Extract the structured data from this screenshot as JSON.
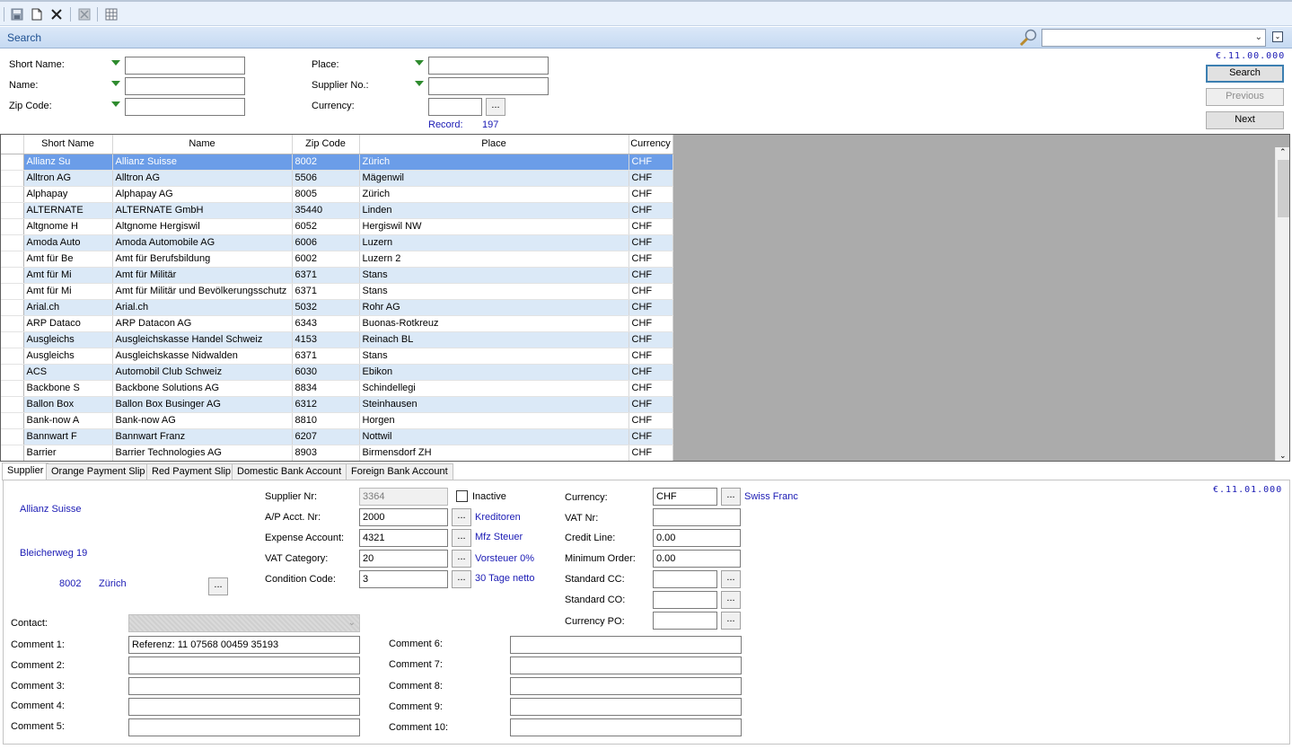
{
  "toolbar": {
    "icons": [
      "save-icon",
      "new-document-icon",
      "delete-icon",
      "cancel-icon",
      "grid-icon"
    ]
  },
  "search_bar": {
    "title": "Search",
    "combo_value": ""
  },
  "search_form": {
    "short_name_label": "Short Name:",
    "name_label": "Name:",
    "zip_label": "Zip Code:",
    "place_label": "Place:",
    "supplier_no_label": "Supplier No.:",
    "currency_label": "Currency:",
    "short_name_value": "",
    "name_value": "",
    "zip_value": "",
    "place_value": "",
    "supplier_no_value": "",
    "currency_value": "",
    "dots_label": "...",
    "record_label": "Record:",
    "record_count": "197",
    "version": "€.11.00.000",
    "search_button": "Search",
    "previous_button": "Previous",
    "next_button": "Next"
  },
  "grid": {
    "columns": [
      "Short Name",
      "Name",
      "Zip Code",
      "Place",
      "Currency"
    ],
    "rows": [
      [
        "Allianz Su",
        "Allianz Suisse",
        "8002",
        "Zürich",
        "CHF"
      ],
      [
        "Alltron AG",
        "Alltron AG",
        "5506",
        "Mägenwil",
        "CHF"
      ],
      [
        "Alphapay",
        "Alphapay AG",
        "8005",
        "Zürich",
        "CHF"
      ],
      [
        "ALTERNATE",
        "ALTERNATE GmbH",
        "35440",
        "Linden",
        "CHF"
      ],
      [
        "Altgnome H",
        "Altgnome Hergiswil",
        "6052",
        "Hergiswil NW",
        "CHF"
      ],
      [
        "Amoda Auto",
        "Amoda Automobile AG",
        "6006",
        "Luzern",
        "CHF"
      ],
      [
        "Amt für Be",
        "Amt für Berufsbildung",
        "6002",
        "Luzern 2",
        "CHF"
      ],
      [
        "Amt für Mi",
        "Amt für Militär",
        "6371",
        "Stans",
        "CHF"
      ],
      [
        "Amt für Mi",
        "Amt für Militär und Bevölkerungsschutz",
        "6371",
        "Stans",
        "CHF"
      ],
      [
        "Arial.ch",
        "Arial.ch",
        "5032",
        "Rohr AG",
        "CHF"
      ],
      [
        "ARP Dataco",
        "ARP Datacon AG",
        "6343",
        "Buonas-Rotkreuz",
        "CHF"
      ],
      [
        "Ausgleichs",
        "Ausgleichskasse Handel Schweiz",
        "4153",
        "Reinach BL",
        "CHF"
      ],
      [
        "Ausgleichs",
        "Ausgleichskasse Nidwalden",
        "6371",
        "Stans",
        "CHF"
      ],
      [
        "ACS",
        "Automobil Club Schweiz",
        "6030",
        "Ebikon",
        "CHF"
      ],
      [
        "Backbone S",
        "Backbone Solutions AG",
        "8834",
        "Schindellegi",
        "CHF"
      ],
      [
        "Ballon Box",
        "Ballon Box Businger AG",
        "6312",
        "Steinhausen",
        "CHF"
      ],
      [
        "Bank-now A",
        "Bank-now AG",
        "8810",
        "Horgen",
        "CHF"
      ],
      [
        "Bannwart F",
        "Bannwart Franz",
        "6207",
        "Nottwil",
        "CHF"
      ],
      [
        "Barrier",
        "Barrier Technologies AG",
        "8903",
        "Birmensdorf ZH",
        "CHF"
      ]
    ]
  },
  "tabs": [
    "Supplier",
    "Orange Payment Slip",
    "Red Payment Slip",
    "Domestic Bank Account",
    "Foreign Bank Account"
  ],
  "detail": {
    "version": "€.11.01.000",
    "company": "Allianz Suisse",
    "street": "Bleicherweg 19",
    "zip": "8002",
    "city": "Zürich",
    "supplier_nr_label": "Supplier Nr:",
    "supplier_nr": "3364",
    "inactive_label": "Inactive",
    "ap_acct_label": "A/P Acct. Nr:",
    "ap_acct": "2000",
    "ap_acct_desc": "Kreditoren",
    "expense_label": "Expense Account:",
    "expense": "4321",
    "expense_desc": "Mfz Steuer",
    "vat_cat_label": "VAT Category:",
    "vat_cat": "20",
    "vat_cat_desc": "Vorsteuer 0%",
    "condition_label": "Condition Code:",
    "condition": "3",
    "condition_desc": "30 Tage netto",
    "currency_label": "Currency:",
    "currency": "CHF",
    "currency_desc": "Swiss Franc",
    "vat_nr_label": "VAT Nr:",
    "vat_nr": "",
    "credit_label": "Credit Line:",
    "credit": "0.00",
    "min_order_label": "Minimum Order:",
    "min_order": "0.00",
    "std_cc_label": "Standard CC:",
    "std_cc": "",
    "std_co_label": "Standard CO:",
    "std_co": "",
    "currency_po_label": "Currency PO:",
    "currency_po": "",
    "contact_label": "Contact:",
    "comments_left": [
      {
        "label": "Comment 1:",
        "value": "Referenz: 11 07568 00459 35193"
      },
      {
        "label": "Comment 2:",
        "value": ""
      },
      {
        "label": "Comment 3:",
        "value": ""
      },
      {
        "label": "Comment 4:",
        "value": ""
      },
      {
        "label": "Comment 5:",
        "value": ""
      }
    ],
    "comments_right": [
      {
        "label": "Comment 6:",
        "value": ""
      },
      {
        "label": "Comment 7:",
        "value": ""
      },
      {
        "label": "Comment 8:",
        "value": ""
      },
      {
        "label": "Comment 9:",
        "value": ""
      },
      {
        "label": "Comment 10:",
        "value": ""
      }
    ]
  }
}
